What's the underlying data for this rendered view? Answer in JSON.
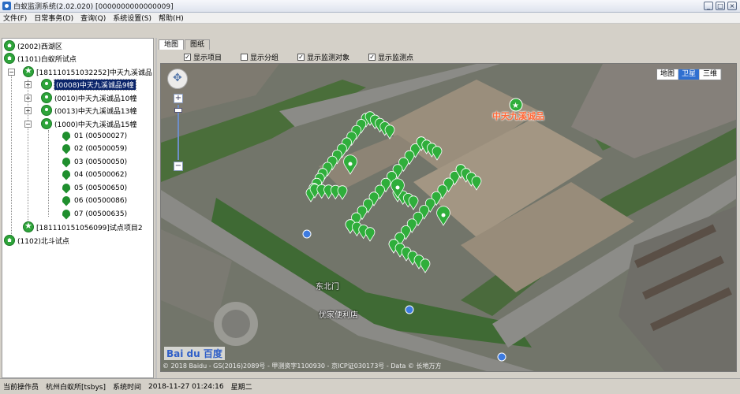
{
  "window": {
    "title": "白蚁监测系统(2.02.020) [0000000000000009]",
    "buttons": [
      "_",
      "□",
      "×"
    ]
  },
  "menu": [
    "文件(F)",
    "日常事务(D)",
    "查询(Q)",
    "系统设置(S)",
    "帮助(H)"
  ],
  "tree": {
    "nodes": [
      {
        "label": "(2002)西湖区",
        "icon": "house-icon"
      },
      {
        "label": "(1101)白蚁所试点",
        "icon": "house-icon"
      },
      {
        "label": "[181110151032252]中天九溪诚品",
        "icon": "star-icon",
        "expander": "−"
      },
      {
        "label": "(0008)中天九溪诚品9幢",
        "icon": "pin-icon",
        "expander": "+",
        "selected": true
      },
      {
        "label": "(0010)中天九溪诚品10幢",
        "icon": "pin-icon",
        "expander": "+"
      },
      {
        "label": "(0013)中天九溪诚品13幢",
        "icon": "pin-icon",
        "expander": "+"
      },
      {
        "label": "(1000)中天九溪诚品15幢",
        "icon": "pin-icon",
        "expander": "−"
      },
      {
        "label": "01 (00500027)",
        "icon": "leaf-icon"
      },
      {
        "label": "02 (00500059)",
        "icon": "leaf-icon"
      },
      {
        "label": "03 (00500050)",
        "icon": "leaf-icon"
      },
      {
        "label": "04 (00500062)",
        "icon": "leaf-icon"
      },
      {
        "label": "05 (00500650)",
        "icon": "leaf-icon"
      },
      {
        "label": "06 (00500086)",
        "icon": "leaf-icon"
      },
      {
        "label": "07 (00500635)",
        "icon": "leaf-icon"
      },
      {
        "label": "[181110151056099]试点项目2",
        "icon": "star-icon"
      },
      {
        "label": "(1102)北斗试点",
        "icon": "house-icon"
      }
    ]
  },
  "tabs": [
    "地图",
    "图纸"
  ],
  "options": [
    {
      "label": "显示项目",
      "checked": true
    },
    {
      "label": "显示分组",
      "checked": false
    },
    {
      "label": "显示监测对象",
      "checked": true
    },
    {
      "label": "显示监测点",
      "checked": true
    }
  ],
  "map": {
    "types": [
      "地图",
      "卫星",
      "三维"
    ],
    "active_type": "卫星",
    "poi_label": "中天九溪诚品",
    "road_labels": [
      "东北门",
      "优家便利店"
    ],
    "copyright": "© 2018 Baidu - GS(2016)2089号 - 甲测资字1100930 - 京ICP证030173号 - Data © 长地万方",
    "logo": "Bai du 百度",
    "zoom_in": "+",
    "zoom_out": "−"
  },
  "status": {
    "operator_label": "当前操作员",
    "operator": "杭州白蚁所[tsbys]",
    "time_label": "系统时间",
    "time": "2018-11-27 01:24:16",
    "weekday": "星期二"
  }
}
